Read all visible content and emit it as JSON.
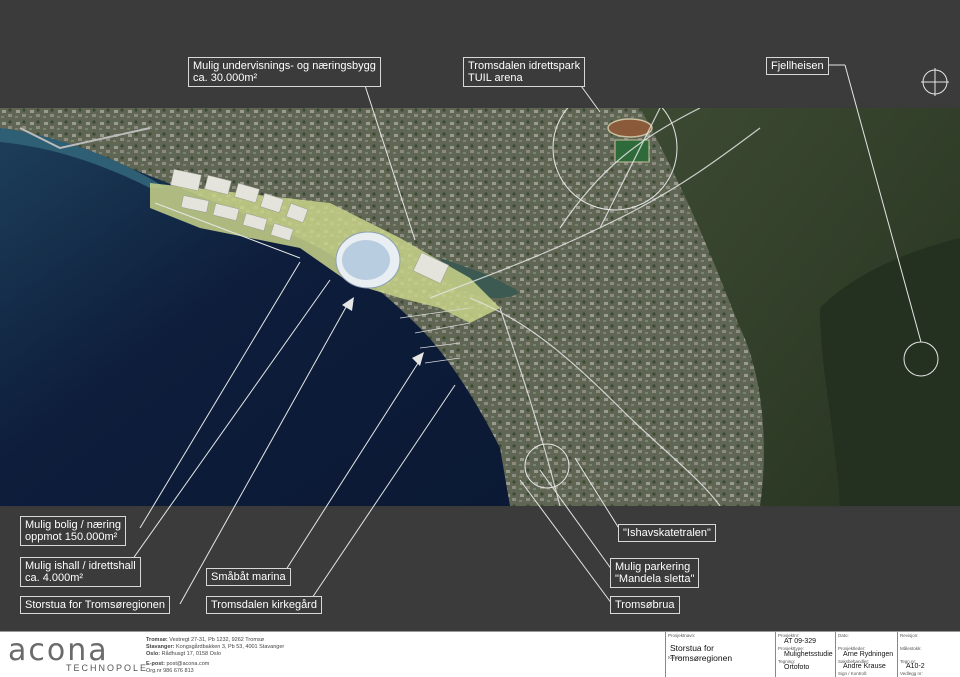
{
  "callouts_top": [
    {
      "id": "undervisning",
      "line1": "Mulig undervisnings- og næringsbygg",
      "line2": "ca. 30.000m²"
    },
    {
      "id": "tuil",
      "line1": "Tromsdalen idrettspark",
      "line2": "TUIL arena"
    },
    {
      "id": "fjellheisen",
      "line1": "Fjellheisen"
    }
  ],
  "callouts_bottom": [
    {
      "id": "bolig",
      "line1": "Mulig bolig / næring",
      "line2": "oppmot 150.000m²"
    },
    {
      "id": "ishall",
      "line1": "Mulig ishall / idrettshall",
      "line2": "ca. 4.000m²"
    },
    {
      "id": "storstua",
      "line1": "Storstua for Tromsøregionen"
    },
    {
      "id": "marina",
      "line1": "Småbåt marina"
    },
    {
      "id": "kirkegard",
      "line1": "Tromsdalen kirkegård"
    },
    {
      "id": "ishavskatetralen",
      "line1": "\"Ishavskatetralen\""
    },
    {
      "id": "parkering",
      "line1": "Mulig parkering",
      "line2": "\"Mandela sletta\""
    },
    {
      "id": "tromsobrua",
      "line1": "Tromsøbrua"
    }
  ],
  "footer": {
    "logo_word": "acona",
    "logo_tag": "TECHNOPOLE",
    "contacts": [
      {
        "city": "Tromsø:",
        "text": "Vestregt 27-31, Pb 1232, 9262 Tromsø"
      },
      {
        "city": "Stavanger:",
        "text": "Kongsgårdbakken 3, Pb 53, 4001 Stavanger"
      },
      {
        "city": "Oslo:",
        "text": "Rådhusgt 17, 0158 Oslo"
      },
      {
        "city": "",
        "text": ""
      },
      {
        "city": "E-post:",
        "text": "post@acona.com"
      },
      {
        "city": "",
        "text": "Org.nr 986 676 813"
      }
    ],
    "titleblock": {
      "prosjektnavn_label": "Prosjektnavn:",
      "prosjektnavn": "Storstua for Tromsøregionen",
      "kunde_label": "Kunde:",
      "prosjektnr_label": "Prosjektnr:",
      "prosjektnr": "AT 09-329",
      "prosjekttype_label": "Prosjekttype:",
      "prosjekttype": "Mulighetsstudie",
      "tegning_label": "Tegning:",
      "tegning": "Ortofoto",
      "dato_label": "Dato:",
      "prosjektleder_label": "Prosjektleder:",
      "prosjektleder": "Arne Rydningen",
      "saksbehandler_label": "Saksbehandler:",
      "saksbehandler": "Andre Krause",
      "sign_label": "Sign / Kontroll:",
      "revisjon_label": "Revisjon:",
      "malestokk_label": "Målestokk:",
      "tegnnr_label": "Tegn.nr:",
      "tegnnr": "A10-2",
      "vedlegg_label": "Vedlegg nr:"
    }
  },
  "colors": {
    "band": "#3b3b3b",
    "water_deep": "#0e1e3c",
    "water_shallow": "#2f5f74",
    "land": "#5d6650",
    "forest": "#2e3f2a",
    "development": "#c9d48a",
    "leader_lines": "#e6e6e6"
  }
}
